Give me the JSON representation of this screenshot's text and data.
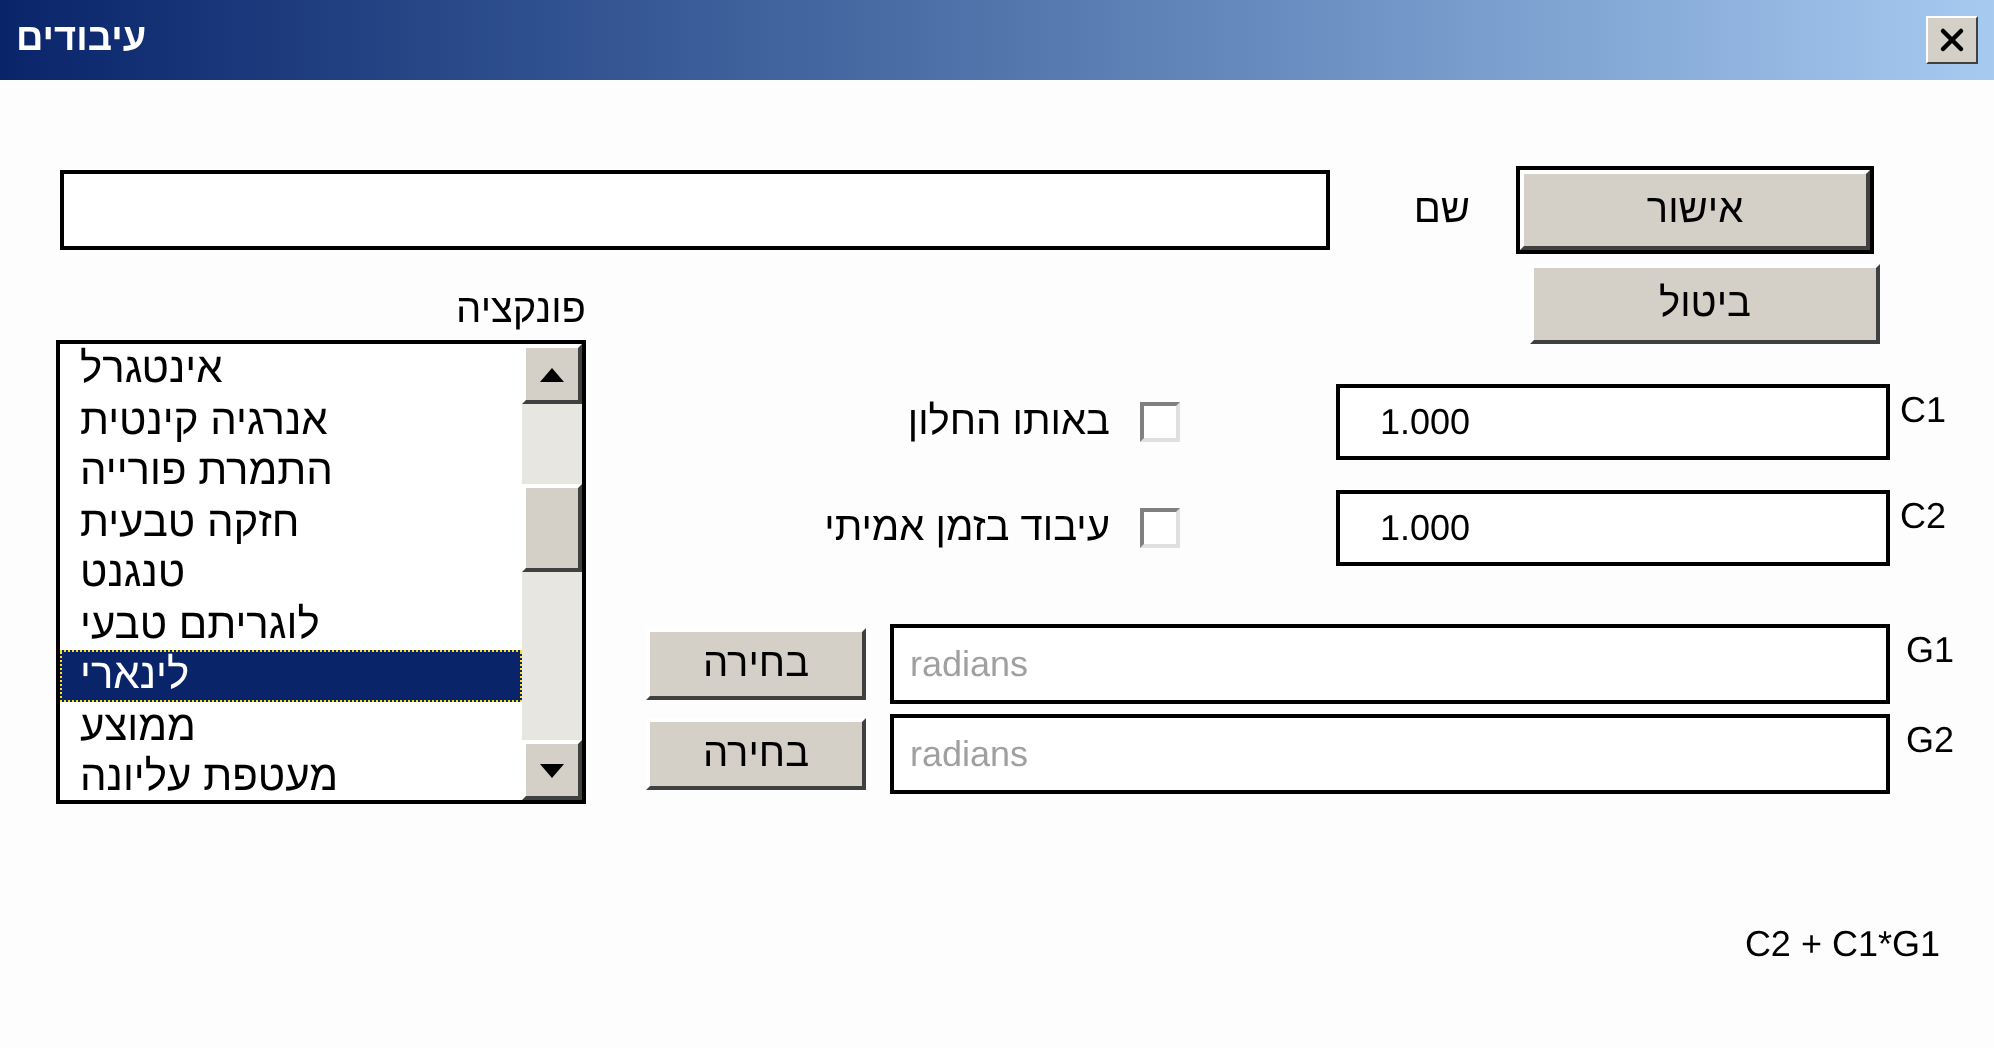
{
  "window": {
    "title": "עיבודים"
  },
  "name_field": {
    "label": "שם"
  },
  "buttons": [
    {
      "label": "אישור",
      "default": true
    },
    {
      "label": "ביטול",
      "default": false
    }
  ],
  "function_list": {
    "label": "פונקציה",
    "items": [
      {
        "label": "אינטגרל",
        "selected": false
      },
      {
        "label": "אנרגיה קינטית",
        "selected": false
      },
      {
        "label": "התמרת פורייה",
        "selected": false
      },
      {
        "label": "חזקה טבעית",
        "selected": false
      },
      {
        "label": "טנגנט",
        "selected": false
      },
      {
        "label": "לוגריתם טבעי",
        "selected": false
      },
      {
        "label": "לינארי",
        "selected": true
      },
      {
        "label": "ממוצע",
        "selected": false
      },
      {
        "label": "מעטפת עליונה",
        "selected": false
      }
    ]
  },
  "options": [
    {
      "label": "באותו החלון",
      "checked": false
    },
    {
      "label": "עיבוד בזמן אמיתי",
      "checked": false
    }
  ],
  "coefficients": [
    {
      "label": "C1",
      "value": "1.000"
    },
    {
      "label": "C2",
      "value": "1.000"
    }
  ],
  "units": [
    {
      "label": "G1",
      "placeholder": "radians",
      "button": "בחירה"
    },
    {
      "label": "G2",
      "placeholder": "radians",
      "button": "בחירה"
    }
  ],
  "formula": "C2 + C1*G1"
}
